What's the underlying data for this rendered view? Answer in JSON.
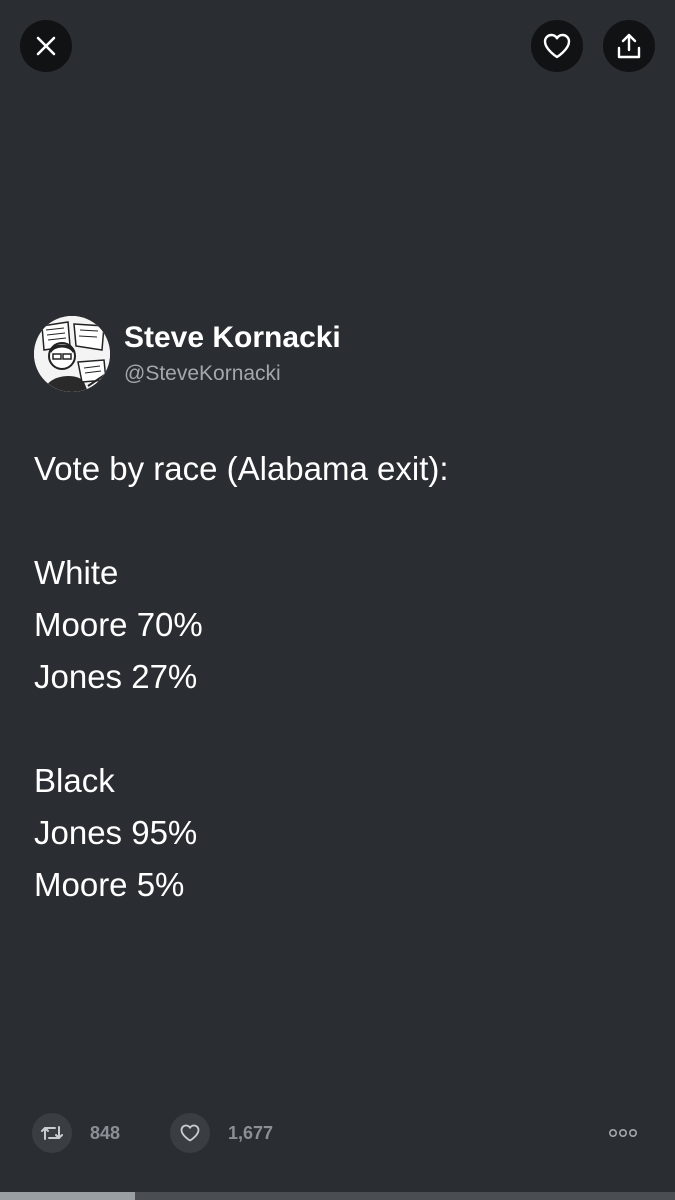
{
  "top_bar": {
    "close_icon": "close-icon",
    "like_icon": "heart-outline-icon",
    "share_icon": "share-upload-icon"
  },
  "author": {
    "name": "Steve Kornacki",
    "handle": "@SteveKornacki",
    "avatar_icon": "avatar-cartoon"
  },
  "tweet": {
    "lines": [
      "Vote by race (Alabama exit):",
      "",
      "White",
      "Moore 70%",
      "Jones 27%",
      "",
      "Black",
      "Jones 95%",
      "Moore 5%"
    ]
  },
  "actions": {
    "retweet_count": "848",
    "like_count": "1,677",
    "retweet_icon": "retweet-icon",
    "like_icon": "heart-outline-icon",
    "more_icon": "more-dots-icon"
  },
  "progress": {
    "fraction": 0.2
  },
  "colors": {
    "background": "#2a2d31",
    "button_bg": "#101214",
    "text": "#ffffff",
    "secondary_text": "#a3a8ad",
    "action_count": "#8b9096"
  }
}
